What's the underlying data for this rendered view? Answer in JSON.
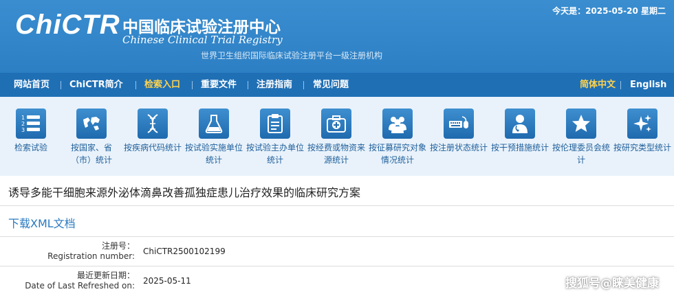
{
  "header": {
    "logo_text": "ChiCTR",
    "cn_title": "中国临床试验注册中心",
    "en_title": "Chinese Clinical Trial Registry",
    "who_subtitle": "世界卫生组织国际临床试验注册平台一级注册机构",
    "today": "今天是：2025-05-20 星期二"
  },
  "nav": {
    "items": [
      {
        "label": "网站首页"
      },
      {
        "label": "ChiCTR简介"
      },
      {
        "label": "检索入口"
      },
      {
        "label": "重要文件"
      },
      {
        "label": "注册指南"
      },
      {
        "label": "常见问题"
      }
    ],
    "lang_cn": "简体中文",
    "lang_en": "English",
    "active_color": "#ffd34d"
  },
  "icon_bar": {
    "items": [
      {
        "icon": "list-icon",
        "label": "检索试验"
      },
      {
        "icon": "globe-map-icon",
        "label": "按国家、省（市）统计"
      },
      {
        "icon": "dna-icon",
        "label": "按疾病代码统计"
      },
      {
        "icon": "flask-icon",
        "label": "按试验实施单位统计"
      },
      {
        "icon": "clipboard-icon",
        "label": "按试验主办单位统计"
      },
      {
        "icon": "medical-kit-icon",
        "label": "按经费或物资来源统计"
      },
      {
        "icon": "people-icon",
        "label": "按征募研究对象情况统计"
      },
      {
        "icon": "keyboard-mouse-icon",
        "label": "按注册状态统计"
      },
      {
        "icon": "doctor-icon",
        "label": "按干预措施统计"
      },
      {
        "icon": "star-icon",
        "label": "按伦理委员会统计"
      },
      {
        "icon": "sparkle-icon",
        "label": "按研究类型统计"
      }
    ]
  },
  "trial": {
    "title": "诱导多能干细胞来源外泌体滴鼻改善孤独症患儿治疗效果的临床研究方案",
    "xml_link": "下载XML文档",
    "fields": [
      {
        "label_cn": "注册号：",
        "label_en": "Registration number:",
        "value": "ChiCTR2500102199"
      },
      {
        "label_cn": "最近更新日期：",
        "label_en": "Date of Last Refreshed on:",
        "value": "2025-05-11"
      }
    ]
  },
  "watermark": "搜狐号@睐美健康",
  "colors": {
    "header_blue": "#2d7fc4",
    "nav_blue": "#1f6fb5",
    "icon_bar_bg": "#e9f2fb",
    "link_blue": "#2a7ac0"
  }
}
